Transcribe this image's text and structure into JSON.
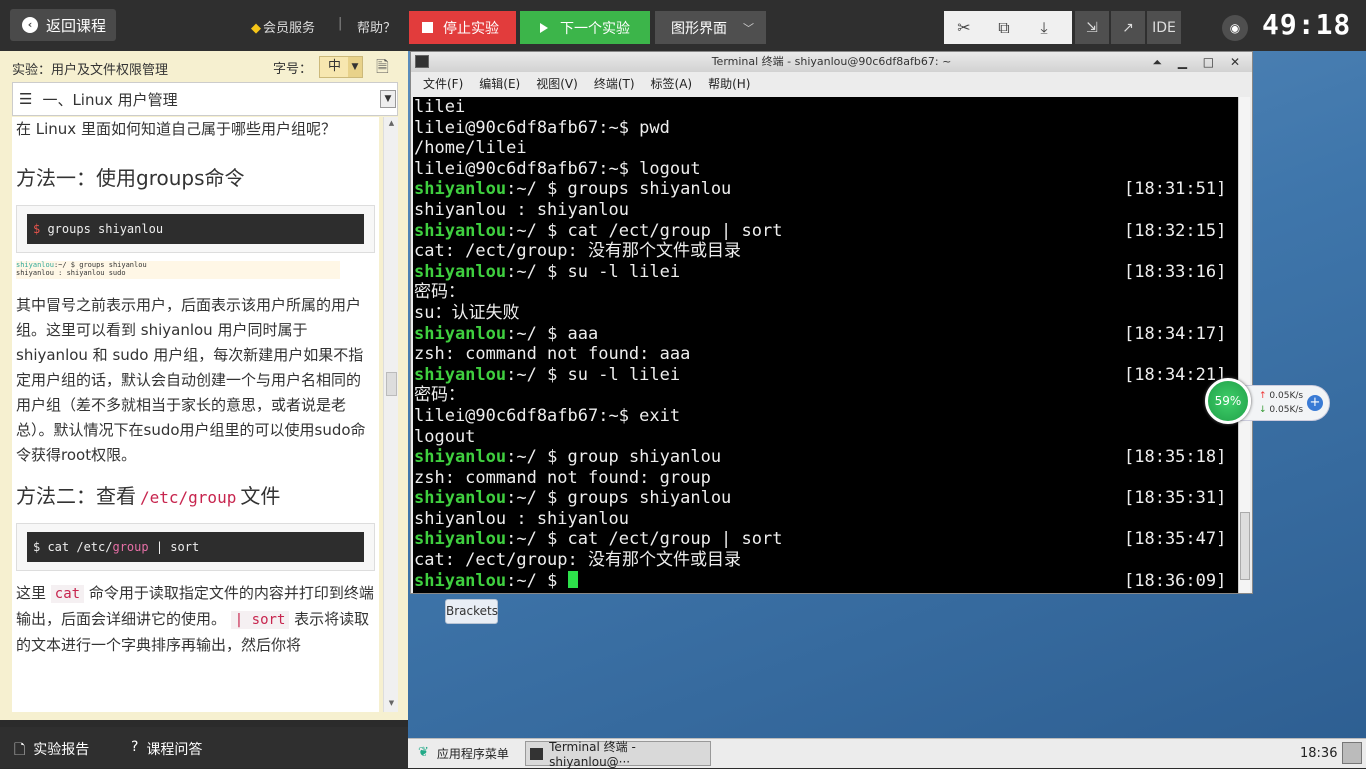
{
  "topbar": {
    "back_label": "返回课程",
    "vip_label": "会员服务",
    "separator": "|",
    "help_label": "帮助？",
    "stop_label": "停止实验",
    "next_label": "下一个实验",
    "gui_label": "图形界面",
    "ide_label": "IDE",
    "timer": "49:18"
  },
  "sidebar": {
    "experiment_title": "实验：用户及文件权限管理",
    "font_label": "字号：",
    "font_value": "中",
    "section_title": "一、Linux 用户管理",
    "intro": "在 Linux 里面如何知道自己属于哪些用户组呢？",
    "method1_title": "方法一：使用groups命令",
    "code1_prompt": "$",
    "code1_cmd": " groups shiyanlou",
    "mini_line1_user": "shiyanlou",
    "mini_line1_rest": ":~/ $ groups shiyanlou",
    "mini_line2": "shiyanlou : shiyanlou sudo",
    "para1": "其中冒号之前表示用户，后面表示该用户所属的用户组。这里可以看到 shiyanlou 用户同时属于 shiyanlou 和 sudo 用户组，每次新建用户如果不指定用户组的话，默认会自动创建一个与用户名相同的用户组（差不多就相当于家长的意思，或者说是老总）。默认情况下在sudo用户组里的可以使用sudo命令获得root权限。",
    "method2_prefix": "方法二：查看",
    "method2_code": "/etc/group",
    "method2_suffix": "文件",
    "code2_pre": "$ cat /etc/",
    "code2_hl": "group",
    "code2_post": " | sort",
    "para2_a": "这里",
    "para2_code1": "cat",
    "para2_b": "命令用于读取指定文件的内容并打印到终端输出，后面会详细讲它的使用。",
    "para2_code2": "| sort",
    "para2_c": "表示将读取的文本进行一个字典排序再输出，然后你将"
  },
  "bottombar": {
    "report_label": "实验报告",
    "qa_label": "课程问答"
  },
  "terminal": {
    "title": "Terminal 终端 - shiyanlou@90c6df8afb67: ~",
    "menu": [
      "文件(F)",
      "编辑(E)",
      "视图(V)",
      "终端(T)",
      "标签(A)",
      "帮助(H)"
    ],
    "lines": [
      {
        "text": "lilei"
      },
      {
        "text": "lilei@90c6df8afb67:~$ pwd"
      },
      {
        "text": "/home/lilei"
      },
      {
        "text": "lilei@90c6df8afb67:~$ logout"
      },
      {
        "user": "shiyanlou",
        "text": ":~/ $ groups shiyanlou",
        "ts": "[18:31:51]"
      },
      {
        "text": "shiyanlou : shiyanlou"
      },
      {
        "user": "shiyanlou",
        "text": ":~/ $ cat /ect/group | sort",
        "ts": "[18:32:15]"
      },
      {
        "text": "cat: /ect/group: 没有那个文件或目录"
      },
      {
        "user": "shiyanlou",
        "text": ":~/ $ su -l lilei",
        "ts": "[18:33:16]"
      },
      {
        "text": "密码："
      },
      {
        "text": "su：认证失败"
      },
      {
        "user": "shiyanlou",
        "text": ":~/ $ aaa",
        "ts": "[18:34:17]"
      },
      {
        "text": "zsh: command not found: aaa"
      },
      {
        "user": "shiyanlou",
        "text": ":~/ $ su -l lilei",
        "ts": "[18:34:21]"
      },
      {
        "text": "密码："
      },
      {
        "text": "lilei@90c6df8afb67:~$ exit"
      },
      {
        "text": "logout"
      },
      {
        "user": "shiyanlou",
        "text": ":~/ $ group shiyanlou",
        "ts": "[18:35:18]"
      },
      {
        "text": "zsh: command not found: group"
      },
      {
        "user": "shiyanlou",
        "text": ":~/ $ groups shiyanlou",
        "ts": "[18:35:31]"
      },
      {
        "text": "shiyanlou : shiyanlou"
      },
      {
        "user": "shiyanlou",
        "text": ":~/ $ cat /ect/group | sort",
        "ts": "[18:35:47]"
      },
      {
        "text": "cat: /ect/group: 没有那个文件或目录"
      },
      {
        "user": "shiyanlou",
        "text": ":~/ $ ",
        "ts": "[18:36:09]",
        "cursor": true
      }
    ]
  },
  "netwidget": {
    "percent": "59%",
    "up": "0.05K/s",
    "down": "0.05K/s"
  },
  "desktop": {
    "brackets_label": "Brackets"
  },
  "taskbar": {
    "app_menu": "应用程序菜单",
    "task_title": "Terminal 终端 - shiyanlou@···",
    "clock": "18:36"
  },
  "colors": {
    "stop": "#e23c3c",
    "next": "#3cb54a",
    "term_user": "#3fcf3f",
    "cursor": "#2de04a"
  }
}
